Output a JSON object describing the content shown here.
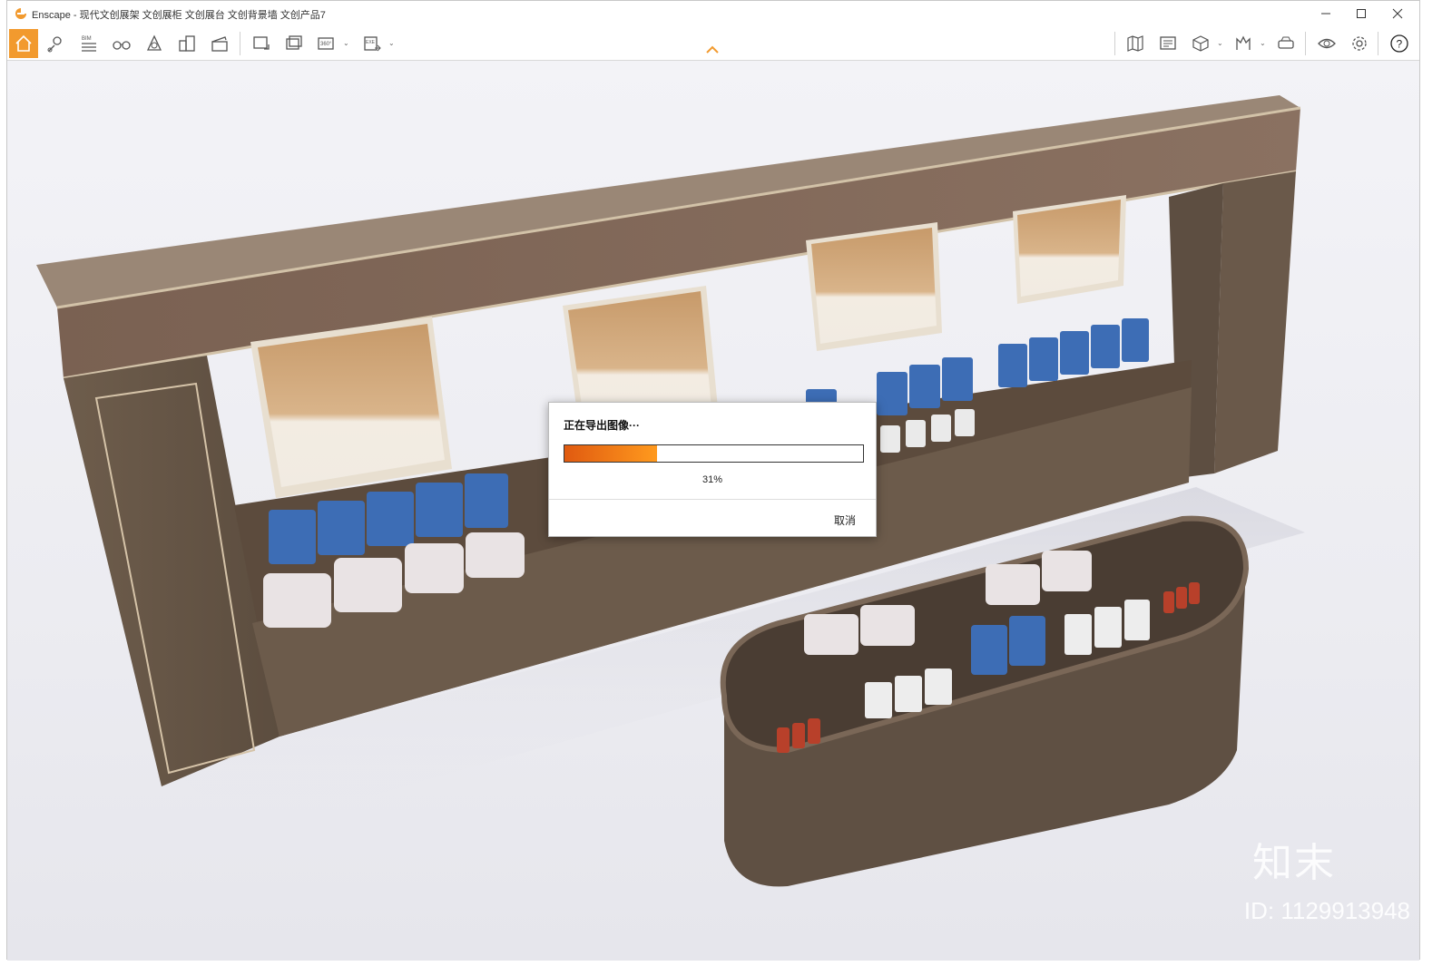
{
  "window": {
    "title": "Enscape - 现代文创展架 文创展柜 文创展台 文创背景墙 文创产品7",
    "controls": [
      "minimize",
      "maximize",
      "close"
    ]
  },
  "toolbar": {
    "left_tools": [
      {
        "name": "home",
        "icon": "home-icon",
        "active": true
      },
      {
        "name": "location",
        "icon": "location-icon"
      },
      {
        "name": "bim",
        "icon": "bim-icon",
        "label": "BIM"
      },
      {
        "name": "binoculars",
        "icon": "binoculars-icon"
      },
      {
        "name": "atmosphere",
        "icon": "atmosphere-icon"
      },
      {
        "name": "buildings",
        "icon": "buildings-icon"
      },
      {
        "name": "clapper",
        "icon": "clapper-icon"
      },
      {
        "name": "screenshot",
        "icon": "screenshot-icon"
      },
      {
        "name": "batch-render",
        "icon": "batch-render-icon"
      },
      {
        "name": "panorama",
        "icon": "panorama-icon",
        "label": "360°"
      },
      {
        "name": "export-exe",
        "icon": "export-exe-icon",
        "label": "EXE"
      }
    ],
    "right_tools": [
      {
        "name": "map",
        "icon": "map-icon"
      },
      {
        "name": "views",
        "icon": "views-icon"
      },
      {
        "name": "cube",
        "icon": "cube-icon"
      },
      {
        "name": "vr",
        "icon": "vr-icon"
      },
      {
        "name": "headset",
        "icon": "headset-icon"
      },
      {
        "name": "eye",
        "icon": "eye-icon"
      },
      {
        "name": "settings",
        "icon": "gear-icon"
      },
      {
        "name": "help",
        "icon": "help-icon",
        "label": "?"
      }
    ]
  },
  "dialog": {
    "title": "正在导出图像···",
    "progress": 0.31,
    "percent_label": "31%",
    "cancel_label": "取消"
  },
  "watermark": {
    "site": "知末",
    "id_label": "ID: 1129913948"
  },
  "colors": {
    "accent": "#f29a2e",
    "progress_start": "#e05a10",
    "progress_end": "#ff9a1e",
    "wood_dark": "#6b5a4a",
    "wood_header": "#7d6454",
    "sky": "#f0f0f5"
  }
}
